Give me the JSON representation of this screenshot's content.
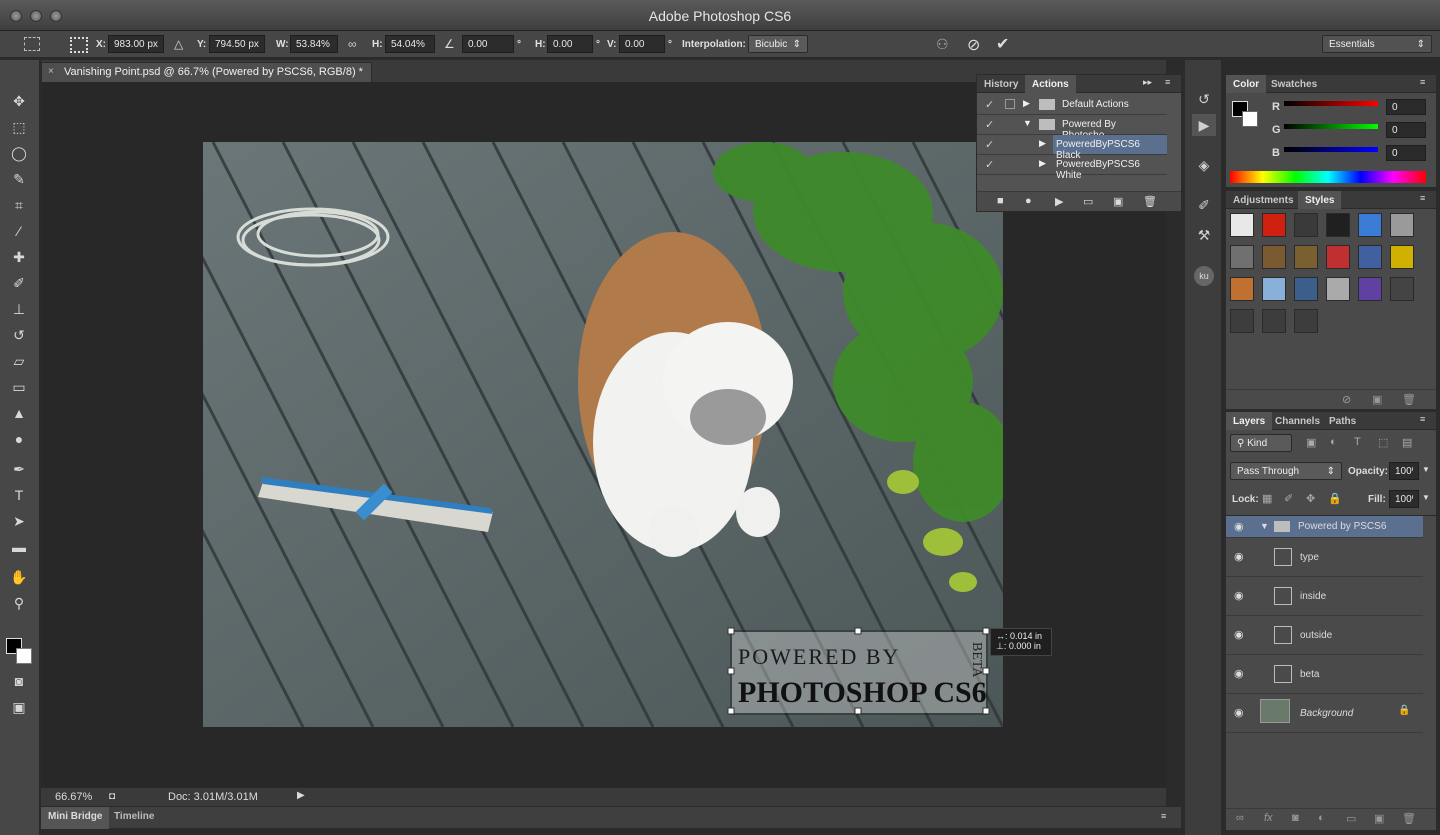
{
  "app": {
    "title": "Adobe Photoshop CS6"
  },
  "options": {
    "x_label": "X:",
    "x_value": "983.00 px",
    "y_label": "Y:",
    "y_value": "794.50 px",
    "w_label": "W:",
    "w_value": "53.84%",
    "h_label": "H:",
    "h_value": "54.04%",
    "rot_value": "0.00",
    "hskew_label": "H:",
    "hskew_value": "0.00",
    "vskew_label": "V:",
    "vskew_value": "0.00",
    "interp_label": "Interpolation:",
    "interp_value": "Bicubic",
    "workspace": "Essentials"
  },
  "document": {
    "tab_title": "Vanishing Point.psd @ 66.7% (Powered by PSCS6, RGB/8) *"
  },
  "status": {
    "zoom": "66.67%",
    "doc": "Doc: 3.01M/3.01M"
  },
  "bottom_tabs": [
    "Mini Bridge",
    "Timeline"
  ],
  "transform_readout": {
    "line1": "↔: 0.014 in",
    "line2": "⊥: 0.000 in"
  },
  "watermark": {
    "line1": "POWERED BY",
    "line2": "PHOTOSHOP CS6",
    "side": "BETA"
  },
  "actions_panel": {
    "tabs": [
      "History",
      "Actions"
    ],
    "rows": [
      "Default Actions",
      "Powered By Photosho...",
      "PoweredByPSCS6 Black",
      "PoweredByPSCS6 White"
    ]
  },
  "color_panel": {
    "tabs": [
      "Color",
      "Swatches"
    ],
    "r_label": "R",
    "r_value": "0",
    "g_label": "G",
    "g_value": "0",
    "b_label": "B",
    "b_value": "0"
  },
  "styles_panel": {
    "tabs": [
      "Adjustments",
      "Styles"
    ],
    "swatch_colors": [
      "#e8e8e8",
      "#d02010",
      "#3a3a3a",
      "#202020",
      "#3a7bd5",
      "#9a9a9a",
      "#707070",
      "#7a5a30",
      "#7a6030",
      "#c03030",
      "#4060a0",
      "#d0b000",
      "#c07030",
      "#88b0d8",
      "#3b5f8a",
      "#aaaaaa",
      "#6040a0",
      "#444444",
      "#3d3d3d",
      "#3d3d3d",
      "#3d3d3d"
    ]
  },
  "layers_panel": {
    "tabs": [
      "Layers",
      "Channels",
      "Paths"
    ],
    "kind": "Kind",
    "blend_mode": "Pass Through",
    "opacity_label": "Opacity:",
    "opacity_value": "100%",
    "lock_label": "Lock:",
    "fill_label": "Fill:",
    "fill_value": "100%",
    "layers": [
      "Powered by PSCS6",
      "type",
      "inside",
      "outside",
      "beta",
      "Background"
    ]
  },
  "colors": {
    "accent_select": "#5b6f8f",
    "panel_bg": "#4a4a4a"
  }
}
